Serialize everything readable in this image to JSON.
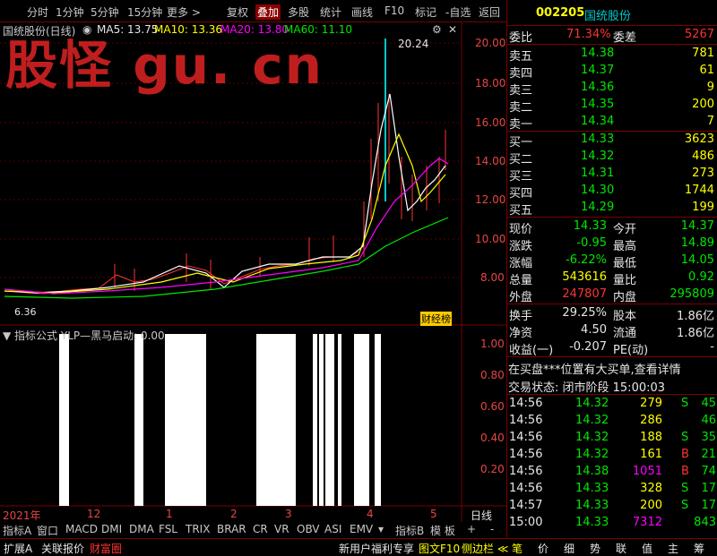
{
  "toolbar": {
    "left": [
      "分时",
      "1分钟",
      "5分钟",
      "15分钟",
      "更多 >"
    ],
    "right": [
      "复权",
      "叠加",
      "多股",
      "统计",
      "画线",
      "F10",
      "标记",
      "-自选",
      "返回"
    ]
  },
  "chart_title": "国统股份(日线)",
  "ma": {
    "ma5": "MA5: 13.75",
    "ma10": "MA10: 13.36",
    "ma20": "MA20: 13.80",
    "ma60": "MA60: 11.10"
  },
  "watermark": "股怪 gu. cn",
  "price_axis": [
    "20.00",
    "18.00",
    "16.00",
    "14.00",
    "12.00",
    "10.00",
    "8.00"
  ],
  "peak_label": "20.24",
  "low_label": "6.36",
  "badge": "财经榜",
  "indicator_title": "指标公式 YLP—黑马启动: 0.00",
  "indicator_axis": [
    "1.00",
    "0.80",
    "0.60",
    "0.40",
    "0.20"
  ],
  "x_labels": [
    "2021年",
    "12",
    "1",
    "2",
    "3",
    "4",
    "5"
  ],
  "day_line_label": "日线",
  "chart_data": {
    "type": "bar",
    "title": "指标公式 YLP—黑马启动",
    "ylim": [
      0,
      1.0
    ],
    "note_values": "signal bars value 1.00 in periods shown",
    "bars": [
      {
        "x_start": 66,
        "x_end": 77,
        "value": 1
      },
      {
        "x_start": 150,
        "x_end": 160,
        "value": 1
      },
      {
        "x_start": 184,
        "x_end": 230,
        "value": 1
      },
      {
        "x_start": 286,
        "x_end": 330,
        "value": 1
      },
      {
        "x_start": 349,
        "x_end": 354,
        "value": 1
      },
      {
        "x_start": 356,
        "x_end": 361,
        "value": 1
      },
      {
        "x_start": 363,
        "x_end": 373,
        "value": 1
      },
      {
        "x_start": 377,
        "x_end": 381,
        "value": 1
      },
      {
        "x_start": 395,
        "x_end": 412,
        "value": 1
      },
      {
        "x_start": 418,
        "x_end": 425,
        "value": 1
      }
    ]
  },
  "indicator_tabs": [
    "指标A",
    "窗口",
    "MACD",
    "DMI",
    "DMA",
    "FSL",
    "TRIX",
    "BRAR",
    "CR",
    "VR",
    "OBV",
    "ASI",
    "EMV",
    "▾",
    "指标B",
    "模 板",
    "+",
    "-"
  ],
  "stock": {
    "code": "002205",
    "name": "国统股份"
  },
  "weibi": {
    "label": "委比",
    "value": "71.34%",
    "label2": "委差",
    "value2": "5267"
  },
  "asks": [
    {
      "label": "卖五",
      "price": "14.38",
      "vol": "781"
    },
    {
      "label": "卖四",
      "price": "14.37",
      "vol": "61"
    },
    {
      "label": "卖三",
      "price": "14.36",
      "vol": "9"
    },
    {
      "label": "卖二",
      "price": "14.35",
      "vol": "200"
    },
    {
      "label": "卖一",
      "price": "14.34",
      "vol": "7"
    }
  ],
  "bids": [
    {
      "label": "买一",
      "price": "14.33",
      "vol": "3623"
    },
    {
      "label": "买二",
      "price": "14.32",
      "vol": "486"
    },
    {
      "label": "买三",
      "price": "14.31",
      "vol": "273"
    },
    {
      "label": "买四",
      "price": "14.30",
      "vol": "1744"
    },
    {
      "label": "买五",
      "price": "14.29",
      "vol": "199"
    }
  ],
  "quote": [
    {
      "l1": "现价",
      "v1": "14.33",
      "l2": "今开",
      "v2": "14.37",
      "c1": "g",
      "c2": "g"
    },
    {
      "l1": "涨跌",
      "v1": "-0.95",
      "l2": "最高",
      "v2": "14.89",
      "c1": "g",
      "c2": "g"
    },
    {
      "l1": "涨幅",
      "v1": "-6.22%",
      "l2": "最低",
      "v2": "14.05",
      "c1": "g",
      "c2": "g"
    },
    {
      "l1": "总量",
      "v1": "543616",
      "l2": "量比",
      "v2": "0.92",
      "c1": "y",
      "c2": "g"
    },
    {
      "l1": "外盘",
      "v1": "247807",
      "l2": "内盘",
      "v2": "295809",
      "c1": "r",
      "c2": "g"
    }
  ],
  "fund": [
    {
      "l1": "换手",
      "v1": "29.25%",
      "l2": "股本",
      "v2": "1.86亿"
    },
    {
      "l1": "净资",
      "v1": "4.50",
      "l2": "流通",
      "v2": "1.86亿"
    },
    {
      "l1": "收益(一)",
      "v1": "-0.207",
      "l2": "PE(动)",
      "v2": "-"
    }
  ],
  "notice": "在买盘***位置有大买单,查看详情",
  "trade_status": "交易状态: 闭市阶段 15:00:03",
  "ticks": [
    {
      "t": "14:56",
      "p": "14.32",
      "v": "279",
      "bs": "S",
      "n": "45",
      "vc": "y",
      "bc": "g"
    },
    {
      "t": "14:56",
      "p": "14.32",
      "v": "286",
      "bs": "",
      "n": "46",
      "vc": "y",
      "bc": "g"
    },
    {
      "t": "14:56",
      "p": "14.32",
      "v": "188",
      "bs": "S",
      "n": "35",
      "vc": "y",
      "bc": "g"
    },
    {
      "t": "14:56",
      "p": "14.32",
      "v": "161",
      "bs": "B",
      "n": "21",
      "vc": "y",
      "bc": "r"
    },
    {
      "t": "14:56",
      "p": "14.38",
      "v": "1051",
      "bs": "B",
      "n": "74",
      "vc": "m",
      "bc": "r"
    },
    {
      "t": "14:56",
      "p": "14.33",
      "v": "328",
      "bs": "S",
      "n": "17",
      "vc": "y",
      "bc": "g"
    },
    {
      "t": "14:57",
      "p": "14.33",
      "v": "200",
      "bs": "S",
      "n": "17",
      "vc": "y",
      "bc": "g"
    },
    {
      "t": "15:00",
      "p": "14.33",
      "v": "7312",
      "bs": "",
      "n": "843",
      "vc": "m",
      "bc": "g"
    }
  ],
  "bottom_left": [
    "扩展A",
    "关联报价",
    "财富圈"
  ],
  "bottom_mid": [
    "新用户福利专享",
    "图文F10",
    "侧边栏 ≪"
  ],
  "bottom_right": [
    "笔",
    "价",
    "细",
    "势",
    "联",
    "值",
    "主",
    "筹"
  ]
}
